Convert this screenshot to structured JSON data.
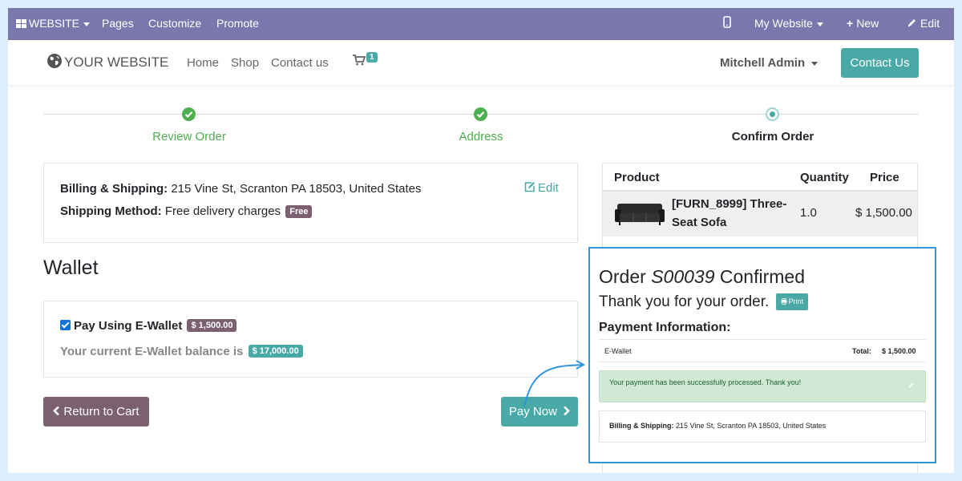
{
  "adminbar": {
    "website_label": "WEBSITE",
    "pages": "Pages",
    "customize": "Customize",
    "promote": "Promote",
    "my_website": "My Website",
    "new": "New",
    "edit": "Edit",
    "color": "#7a77ad"
  },
  "header": {
    "logo_text": "YOUR WEBSITE",
    "nav": [
      "Home",
      "Shop",
      "Contact us"
    ],
    "cart_count": "1",
    "user": "Mitchell Admin",
    "contact_button": "Contact Us",
    "accent": "#48a9a6"
  },
  "wizard": {
    "steps": [
      {
        "label": "Review Order",
        "state": "done"
      },
      {
        "label": "Address",
        "state": "done"
      },
      {
        "label": "Confirm Order",
        "state": "current"
      }
    ]
  },
  "billing": {
    "billing_label": "Billing & Shipping:",
    "billing_value": "215 Vine St, Scranton PA 18503, United States",
    "shipping_label": "Shipping Method:",
    "shipping_value": "Free delivery charges",
    "shipping_badge": "Free",
    "edit": "Edit"
  },
  "wallet": {
    "title": "Wallet",
    "checkbox_label": "Pay Using E-Wallet",
    "checked": true,
    "amount_badge": "$ 1,500.00",
    "balance_text": "Your current E-Wallet balance is",
    "balance_badge": "$ 17,000.00"
  },
  "buttons": {
    "return": "Return to Cart",
    "pay": "Pay Now"
  },
  "order_table": {
    "headers": {
      "product": "Product",
      "quantity": "Quantity",
      "price": "Price"
    },
    "rows": [
      {
        "product": "[FURN_8999] Three-Seat Sofa",
        "quantity": "1.0",
        "price": "$ 1,500.00"
      }
    ]
  },
  "confirmation": {
    "title_prefix": "Order",
    "order_ref": "S00039",
    "title_suffix": "Confirmed",
    "thanks": "Thank you for your order.",
    "print": "Print",
    "payment_info": "Payment Information:",
    "method": "E-Wallet",
    "total_label": "Total:",
    "total_value": "$ 1,500.00",
    "success_msg": "Your payment has been successfully processed. Thank you!",
    "billing_label": "Billing & Shipping:",
    "billing_value": "215 Vine St, Scranton PA 18503, United States"
  }
}
